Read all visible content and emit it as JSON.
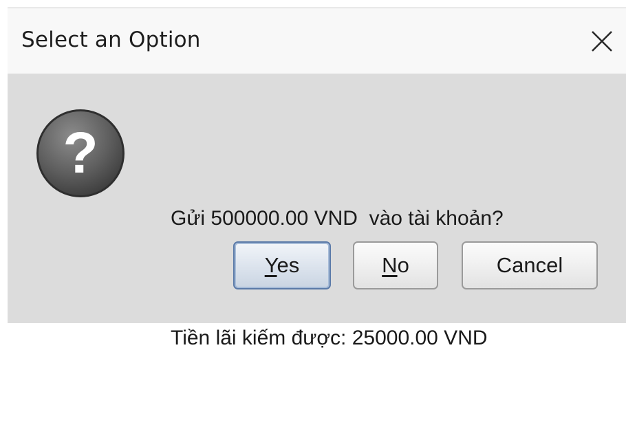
{
  "window": {
    "title": "Select an Option",
    "close_icon": "close-icon"
  },
  "icon": {
    "name": "question-icon",
    "glyph": "?"
  },
  "message": {
    "line1": "Gửi 500000.00 VND  vào tài khoản?",
    "line2": "Tiền lãi kiếm được: 25000.00 VND"
  },
  "buttons": {
    "yes": {
      "mnemonic": "Y",
      "rest": "es",
      "default": true
    },
    "no": {
      "mnemonic": "N",
      "rest": "o"
    },
    "cancel": {
      "label": "Cancel"
    }
  },
  "colors": {
    "dialog_bg": "#dcdcdc",
    "titlebar_bg": "#f8f8f8",
    "default_button_border": "#5b7aa8"
  }
}
